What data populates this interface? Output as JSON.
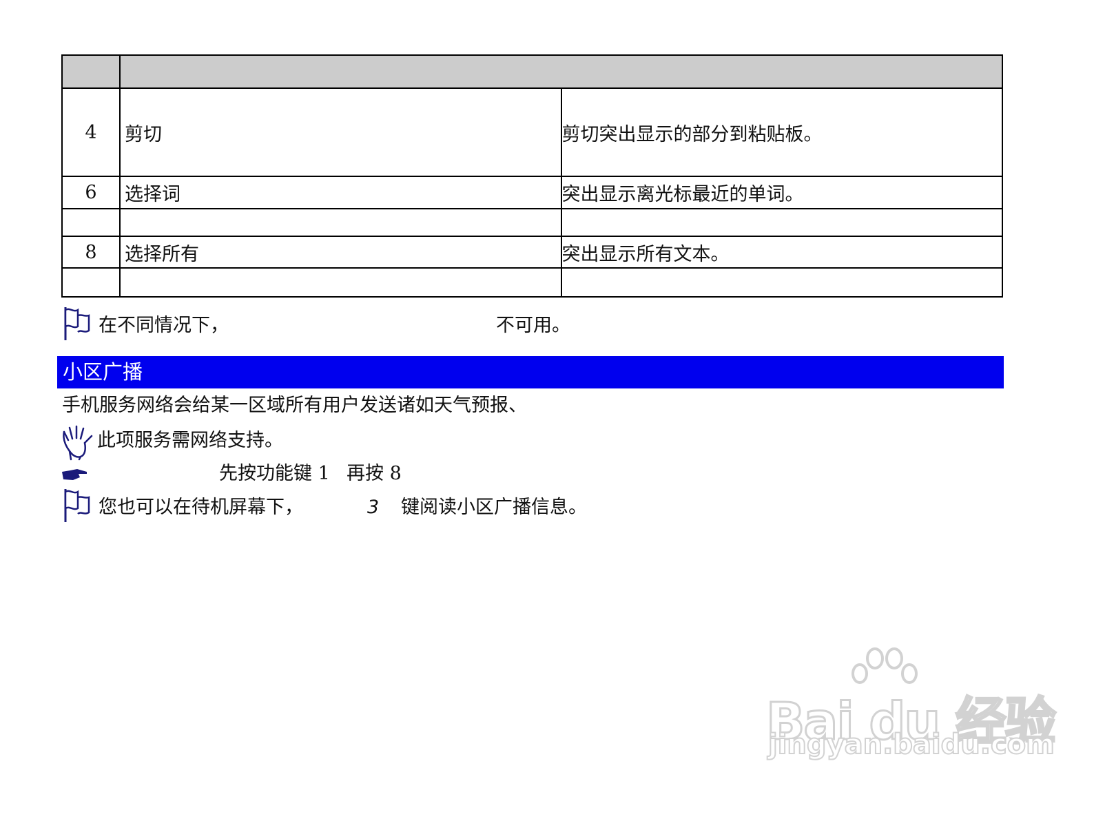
{
  "table": {
    "header": [
      "",
      "",
      ""
    ],
    "rows": [
      {
        "num": "4",
        "name": "剪切",
        "desc": "剪切突出显示的部分到粘贴板。"
      },
      {
        "num": "6",
        "name": "选择词",
        "desc": "突出显示离光标最近的单词。"
      },
      {
        "num": "",
        "name": "",
        "desc": ""
      },
      {
        "num": "8",
        "name": "选择所有",
        "desc": "突出显示所有文本。"
      },
      {
        "num": "",
        "name": "",
        "desc": ""
      }
    ]
  },
  "note1": {
    "part1": "在不同情况下，",
    "part2": "不可用。"
  },
  "section": {
    "title": "小区广播"
  },
  "intro": "手机服务网络会给某一区域所有用户发送诸如天气预报、",
  "tip": "此项服务需网络支持。",
  "shortcut": {
    "part1": "先按功能键 1",
    "part2": "再按 8"
  },
  "note2": {
    "part1": "您也可以在待机屏幕下，",
    "key": "3",
    "part2": "键阅读小区广播信息。"
  },
  "watermark": {
    "logo": "Bai du 经验",
    "url": "jingyan.baidu.com"
  },
  "icons": {
    "note": "flag-note-icon",
    "tip": "raised-hand-icon",
    "pointer": "pointing-hand-icon"
  },
  "colors": {
    "section_bar": "#0000ee",
    "table_header": "#cccccc",
    "icon": "#1a1a7a"
  }
}
